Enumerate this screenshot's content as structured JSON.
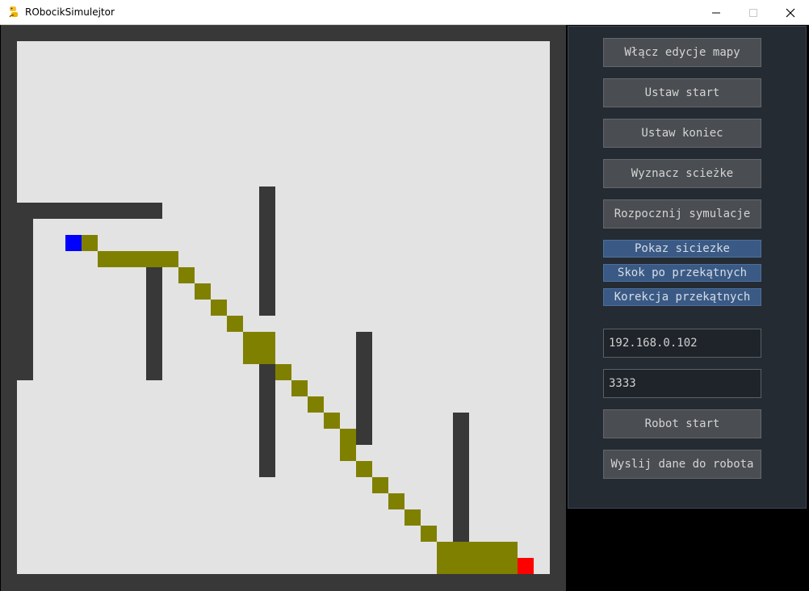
{
  "window": {
    "title": "RObocikSimulejtor",
    "controls": [
      "minimize",
      "maximize",
      "close"
    ]
  },
  "map": {
    "grid_cells": 33,
    "colors": {
      "border": "#383838",
      "floor": "#e3e3e3",
      "wall": "#383838",
      "path": "#808000",
      "start": "#0000ff",
      "end": "#ff0000"
    },
    "walls": [
      [
        1,
        11
      ],
      [
        2,
        11
      ],
      [
        3,
        11
      ],
      [
        4,
        11
      ],
      [
        5,
        11
      ],
      [
        6,
        11
      ],
      [
        7,
        11
      ],
      [
        8,
        11
      ],
      [
        9,
        11
      ],
      [
        1,
        12
      ],
      [
        1,
        13
      ],
      [
        1,
        14
      ],
      [
        1,
        15
      ],
      [
        1,
        16
      ],
      [
        1,
        17
      ],
      [
        1,
        18
      ],
      [
        1,
        19
      ],
      [
        1,
        20
      ],
      [
        1,
        21
      ],
      [
        9,
        15
      ],
      [
        9,
        16
      ],
      [
        9,
        17
      ],
      [
        9,
        18
      ],
      [
        9,
        19
      ],
      [
        9,
        20
      ],
      [
        9,
        21
      ],
      [
        16,
        10
      ],
      [
        16,
        11
      ],
      [
        16,
        12
      ],
      [
        16,
        13
      ],
      [
        16,
        14
      ],
      [
        16,
        15
      ],
      [
        16,
        16
      ],
      [
        16,
        17
      ],
      [
        16,
        19
      ],
      [
        16,
        21
      ],
      [
        16,
        22
      ],
      [
        16,
        23
      ],
      [
        16,
        24
      ],
      [
        16,
        25
      ],
      [
        16,
        26
      ],
      [
        16,
        27
      ],
      [
        22,
        19
      ],
      [
        22,
        20
      ],
      [
        22,
        21
      ],
      [
        22,
        22
      ],
      [
        22,
        23
      ],
      [
        22,
        24
      ],
      [
        22,
        25
      ],
      [
        28,
        24
      ],
      [
        28,
        25
      ],
      [
        28,
        26
      ],
      [
        28,
        27
      ],
      [
        28,
        28
      ],
      [
        28,
        29
      ],
      [
        28,
        30
      ],
      [
        28,
        31
      ]
    ],
    "path": [
      [
        5,
        13
      ],
      [
        6,
        14
      ],
      [
        7,
        14
      ],
      [
        8,
        14
      ],
      [
        9,
        14
      ],
      [
        10,
        14
      ],
      [
        11,
        15
      ],
      [
        12,
        16
      ],
      [
        13,
        17
      ],
      [
        14,
        18
      ],
      [
        15,
        19
      ],
      [
        16,
        19
      ],
      [
        15,
        20
      ],
      [
        16,
        20
      ],
      [
        17,
        21
      ],
      [
        18,
        22
      ],
      [
        19,
        23
      ],
      [
        20,
        24
      ],
      [
        21,
        25
      ],
      [
        21,
        26
      ],
      [
        22,
        27
      ],
      [
        23,
        28
      ],
      [
        24,
        29
      ],
      [
        25,
        30
      ],
      [
        26,
        31
      ],
      [
        27,
        32
      ],
      [
        28,
        32
      ],
      [
        29,
        32
      ],
      [
        30,
        32
      ],
      [
        31,
        32
      ],
      [
        27,
        33
      ],
      [
        28,
        33
      ],
      [
        29,
        33
      ],
      [
        30,
        33
      ],
      [
        31,
        33
      ]
    ],
    "start": [
      4,
      13
    ],
    "end": [
      32,
      33
    ]
  },
  "panel": {
    "buttons": {
      "edit_map": "Włącz edycje mapy",
      "set_start": "Ustaw start",
      "set_end": "Ustaw koniec",
      "find_path": "Wyznacz scieżke",
      "start_sim": "Rozpocznij symulacje",
      "robot_start": "Robot start",
      "send_data": "Wyslij dane do robota"
    },
    "toggles": {
      "show_path": "Pokaz siciezke",
      "diagonal_jump": "Skok po przekątnych",
      "diagonal_correction": "Korekcja przekątnych"
    },
    "inputs": {
      "ip_address": "192.168.0.102",
      "port": "3333"
    }
  }
}
